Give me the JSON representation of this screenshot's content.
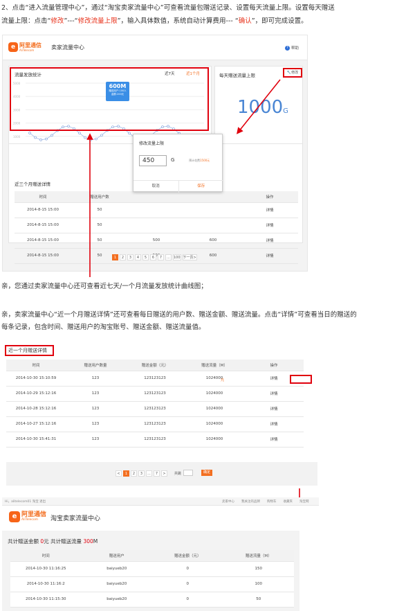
{
  "intro": {
    "line1_prefix": "2、点击“进入流量管理中心”，通过“淘宝卖家流量中心”可查看流量包赠送记录、设置每天流量上限。设置每天赠送",
    "line2_a": "流量上限：点击“",
    "line2_b": "修改",
    "line2_c": "”---“",
    "line2_d": "修改流量上限",
    "line2_e": "”，输入具体数值，系统自动计算费用--- “",
    "line2_f": "确认",
    "line2_g": "”，即可完成设置。"
  },
  "shot1": {
    "logo_text": "阿里通信",
    "logo_sub": "AliTelecom",
    "title": "卖家流量中心",
    "help": "帮助",
    "stats": {
      "title": "流量发放统计",
      "tab_7": "近7天",
      "tab_month": "近1个月",
      "tooltip_value": "600M",
      "tooltip_line1": "赠送用户:100人",
      "tooltip_line2": "金额:200元",
      "y_ticks": [
        "5000",
        "4000",
        "3000",
        "2000",
        "1000"
      ],
      "x_ticks": [
        "6日",
        "17",
        "21",
        "23",
        "25",
        "27",
        "29",
        "31",
        "1日",
        "3",
        "5",
        "7",
        "9",
        "11",
        "13",
        "15"
      ]
    },
    "limit": {
      "title": "每天赠送流量上限",
      "edit": "修改",
      "value": "1000",
      "unit": "G",
      "sent_label": "流量赠送占比：",
      "sent_value": "20%",
      "remain_label": "目前发放总计：",
      "remain_value": "1000G"
    },
    "dialog": {
      "title": "修改流量上限",
      "input_value": "450",
      "unit": "G",
      "estimate_label": "预计花费",
      "estimate_value": "1500元",
      "cancel": "取消",
      "save": "保存"
    },
    "records": {
      "title": "近三个月赠送详情",
      "headers": [
        "时间",
        "赠送用户数",
        "",
        "",
        "操作"
      ],
      "rows": [
        [
          "2014-8-15 15:00",
          "50",
          "",
          "",
          "详情"
        ],
        [
          "2014-8-15 15:00",
          "50",
          "",
          "",
          "详情"
        ],
        [
          "2014-8-15 15:00",
          "50",
          "500",
          "600",
          "详情"
        ],
        [
          "2014-8-15 15:00",
          "50",
          "500",
          "600",
          "详情"
        ]
      ]
    },
    "pager": [
      "1",
      "2",
      "3",
      "4",
      "5",
      "6",
      "7",
      "...",
      "100",
      "下一页>"
    ]
  },
  "text2": "亲，您通过卖家流量中心还可查看近七天/一个月流量发放统计曲线图；",
  "text3_line1": "亲，卖家流量中心“近一个月赠送详情”还可查看每日赠送的用户数、赠送金额、赠送流量。点击“详情”可查看当日的赠送的",
  "text3_line2": "每条记录，包含时间、赠送用户的淘宝账号、赠送金额、赠送流量值。",
  "shot2": {
    "title": "近一个月赠送详情",
    "headers": [
      "时间",
      "赠送用户数量",
      "赠送金额（元）",
      "赠送流量（M）",
      "操作"
    ],
    "rows": [
      [
        "2014-10-30 15:10:59",
        "123",
        "123123123",
        "1024000",
        "详情"
      ],
      [
        "2014-10-29 15:12:16",
        "123",
        "123123123",
        "1024000",
        "详情"
      ],
      [
        "2014-10-28 15:12:16",
        "123",
        "123123123",
        "1024000",
        "详情"
      ],
      [
        "2014-10-27 15:12:16",
        "123",
        "123123123",
        "1024000",
        "详情"
      ],
      [
        "2014-10-30 15:41:31",
        "123",
        "123123123",
        "1024000",
        "详情"
      ]
    ],
    "yuan": "元",
    "pager": [
      "<",
      "1",
      "2",
      "3",
      "...",
      "7",
      ">"
    ],
    "goto_label": "共跳",
    "go": "确定"
  },
  "shot3": {
    "topbar_left": "Hi，alitelecom01  淘宝  退出",
    "topbar_items": [
      "卖家中心",
      "我关注的品牌",
      "购物车",
      "收藏夹",
      "淘宝网"
    ],
    "logo_text": "阿里通信",
    "logo_sub": "AliTelecom",
    "title": "淘宝卖家流量中心",
    "summary_a": "共计赠送金额 ",
    "summary_b": "0",
    "summary_c": "元 共计赠送流量 ",
    "summary_d": "300",
    "summary_e": "M",
    "headers": [
      "时间",
      "赠送用户",
      "赠送金额（元）",
      "赠送流量（M）"
    ],
    "rows": [
      [
        "2014-10-30 11:16:25",
        "baiyueb20",
        "0",
        "150"
      ],
      [
        "2014-10-30 11:16:2",
        "baiyueb20",
        "0",
        "100"
      ],
      [
        "2014-10-30 11:15:30",
        "baiyueb20",
        "0",
        "50"
      ]
    ]
  },
  "colors": {
    "accent": "#f36f21",
    "red": "#e0000d",
    "link": "#3b72c8",
    "blue_big": "#4a86d4"
  }
}
